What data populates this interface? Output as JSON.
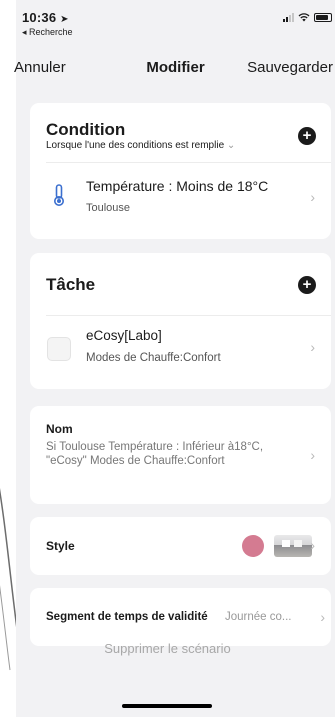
{
  "status": {
    "time": "10:36",
    "back_label": "◂ Recherche"
  },
  "nav": {
    "cancel": "Annuler",
    "title": "Modifier",
    "save": "Sauvegarder"
  },
  "condition": {
    "title": "Condition",
    "subtitle": "Lorsque l'une des conditions est remplie",
    "subtitle_chevron": "⌄",
    "add_icon": "plus-icon",
    "item": {
      "icon": "thermometer-icon",
      "title": "Température : Moins de 18°C",
      "location": "Toulouse"
    }
  },
  "task": {
    "title": "Tâche",
    "add_icon": "plus-icon",
    "item": {
      "icon": "device-icon",
      "title": "eCosy[Labo]",
      "detail": "Modes de Chauffe:Confort"
    }
  },
  "name": {
    "label": "Nom",
    "value": "Si Toulouse Température : Inférieur à18°C, \"eCosy\" Modes de Chauffe:Confort"
  },
  "style": {
    "label": "Style",
    "color": "#d47b91"
  },
  "validity": {
    "label": "Segment de temps de validité",
    "value": "Journée co..."
  },
  "delete_label": "Supprimer le scénario",
  "chevron": "›",
  "colors": {
    "background": "#f2f2f4",
    "card": "#ffffff",
    "accent_icon": "#3b6fcf"
  }
}
